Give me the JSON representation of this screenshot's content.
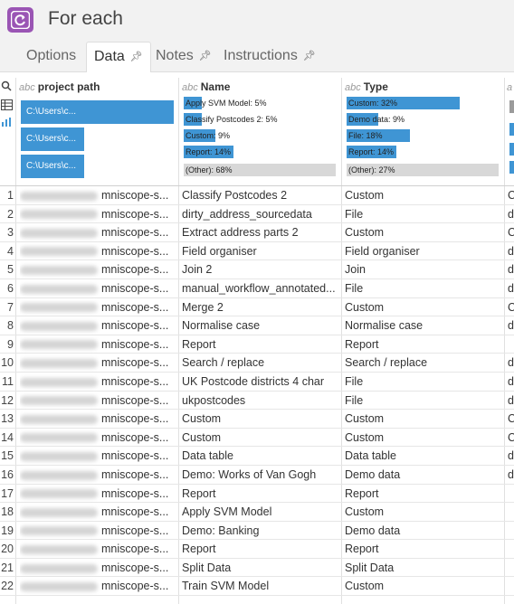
{
  "header": {
    "title": "For each",
    "icon": "refresh-loop-icon",
    "icon_color": "#9a55b4"
  },
  "tabs": [
    {
      "label": "Options",
      "pinned": false,
      "active": false
    },
    {
      "label": "Data",
      "pinned": true,
      "active": true
    },
    {
      "label": "Notes",
      "pinned": true,
      "active": false
    },
    {
      "label": "Instructions",
      "pinned": true,
      "active": false
    }
  ],
  "tools": [
    "search-icon",
    "table-view-icon",
    "chart-view-icon"
  ],
  "columns": {
    "path": {
      "type_label": "abc",
      "title": "project path",
      "summary": [
        "C:\\Users\\c...",
        "C:\\Users\\c...",
        "C:\\Users\\c..."
      ]
    },
    "name": {
      "type_label": "abc",
      "title": "Name",
      "summary": [
        {
          "label": "Apply SVM Model: 5%",
          "pct": 5,
          "other": false
        },
        {
          "label": "Classify Postcodes 2: 5%",
          "pct": 5,
          "other": false
        },
        {
          "label": "Custom: 9%",
          "pct": 9,
          "other": false
        },
        {
          "label": "Report: 14%",
          "pct": 14,
          "other": false
        },
        {
          "label": "(Other): 68%",
          "pct": 68,
          "other": true
        }
      ]
    },
    "type": {
      "type_label": "abc",
      "title": "Type",
      "summary": [
        {
          "label": "Custom: 32%",
          "pct": 32,
          "other": false
        },
        {
          "label": "Demo data: 9%",
          "pct": 9,
          "other": false
        },
        {
          "label": "File: 18%",
          "pct": 18,
          "other": false
        },
        {
          "label": "Report: 14%",
          "pct": 14,
          "other": false
        },
        {
          "label": "(Other): 27%",
          "pct": 27,
          "other": true
        }
      ]
    },
    "accent_color": "#3f95d4"
  },
  "rows": [
    {
      "n": "1",
      "path": "mniscope-s...",
      "name": "Classify Postcodes 2",
      "type": "Custom",
      "extra": "C"
    },
    {
      "n": "2",
      "path": "mniscope-s...",
      "name": "dirty_address_sourcedata",
      "type": "File",
      "extra": "d"
    },
    {
      "n": "3",
      "path": "mniscope-s...",
      "name": "Extract address parts 2",
      "type": "Custom",
      "extra": "C"
    },
    {
      "n": "4",
      "path": "mniscope-s...",
      "name": "Field organiser",
      "type": "Field organiser",
      "extra": "d"
    },
    {
      "n": "5",
      "path": "mniscope-s...",
      "name": "Join 2",
      "type": "Join",
      "extra": "d"
    },
    {
      "n": "6",
      "path": "mniscope-s...",
      "name": "manual_workflow_annotated...",
      "type": "File",
      "extra": "d"
    },
    {
      "n": "7",
      "path": "mniscope-s...",
      "name": "Merge 2",
      "type": "Custom",
      "extra": "C"
    },
    {
      "n": "8",
      "path": "mniscope-s...",
      "name": "Normalise case",
      "type": "Normalise case",
      "extra": "d"
    },
    {
      "n": "9",
      "path": "mniscope-s...",
      "name": "Report",
      "type": "Report",
      "extra": ""
    },
    {
      "n": "10",
      "path": "mniscope-s...",
      "name": "Search / replace",
      "type": "Search / replace",
      "extra": "d"
    },
    {
      "n": "11",
      "path": "mniscope-s...",
      "name": "UK Postcode districts 4 char",
      "type": "File",
      "extra": "d"
    },
    {
      "n": "12",
      "path": "mniscope-s...",
      "name": "ukpostcodes",
      "type": "File",
      "extra": "d"
    },
    {
      "n": "13",
      "path": "mniscope-s...",
      "name": "Custom",
      "type": "Custom",
      "extra": "C"
    },
    {
      "n": "14",
      "path": "mniscope-s...",
      "name": "Custom",
      "type": "Custom",
      "extra": "C"
    },
    {
      "n": "15",
      "path": "mniscope-s...",
      "name": "Data table",
      "type": "Data table",
      "extra": "d"
    },
    {
      "n": "16",
      "path": "mniscope-s...",
      "name": "Demo: Works of Van Gogh",
      "type": "Demo data",
      "extra": "d"
    },
    {
      "n": "17",
      "path": "mniscope-s...",
      "name": "Report",
      "type": "Report",
      "extra": ""
    },
    {
      "n": "18",
      "path": "mniscope-s...",
      "name": "Apply SVM Model",
      "type": "Custom",
      "extra": ""
    },
    {
      "n": "19",
      "path": "mniscope-s...",
      "name": "Demo: Banking",
      "type": "Demo data",
      "extra": ""
    },
    {
      "n": "20",
      "path": "mniscope-s...",
      "name": "Report",
      "type": "Report",
      "extra": ""
    },
    {
      "n": "21",
      "path": "mniscope-s...",
      "name": "Split Data",
      "type": "Split Data",
      "extra": ""
    },
    {
      "n": "22",
      "path": "mniscope-s...",
      "name": "Train SVM Model",
      "type": "Custom",
      "extra": ""
    }
  ]
}
